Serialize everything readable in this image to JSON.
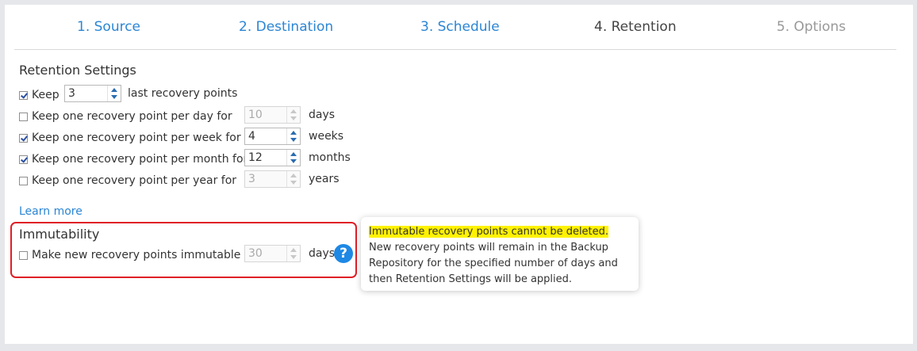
{
  "tabs": [
    {
      "label": "1. Source",
      "state": "link"
    },
    {
      "label": "2. Destination",
      "state": "link"
    },
    {
      "label": "3. Schedule",
      "state": "link"
    },
    {
      "label": "4. Retention",
      "state": "active"
    },
    {
      "label": "5. Options",
      "state": "disabled"
    }
  ],
  "retention": {
    "title": "Retention Settings",
    "keep": {
      "checked": true,
      "label": "Keep",
      "value": "3",
      "suffix": "last recovery points"
    },
    "per_day": {
      "checked": false,
      "label": "Keep one recovery point per day for",
      "value": "10",
      "unit": "days"
    },
    "per_week": {
      "checked": true,
      "label": "Keep one recovery point per week for",
      "value": "4",
      "unit": "weeks"
    },
    "per_month": {
      "checked": true,
      "label": "Keep one recovery point per month for",
      "value": "12",
      "unit": "months"
    },
    "per_year": {
      "checked": false,
      "label": "Keep one recovery point per year for",
      "value": "3",
      "unit": "years"
    }
  },
  "learn_more": "Learn more",
  "immutability": {
    "title": "Immutability",
    "checked": false,
    "label": "Make new recovery points immutable for",
    "value": "30",
    "unit": "days",
    "help_glyph": "?"
  },
  "tooltip": {
    "highlight": "Immutable recovery points cannot be deleted.",
    "text": " New recovery points will remain in the Backup Repository for the specified number of days and then Retention Settings will be applied."
  },
  "colors": {
    "link": "#2b86d4",
    "highlight": "#fff200",
    "alert_border": "#e01f26",
    "help_icon": "#1e88e5"
  }
}
